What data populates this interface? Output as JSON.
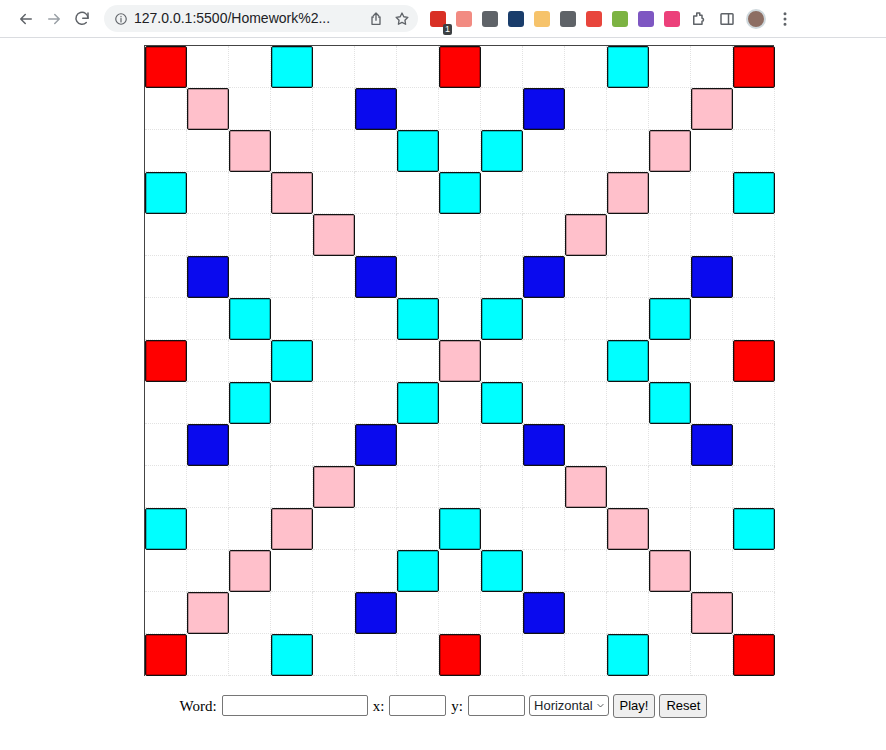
{
  "browser": {
    "address": "127.0.0.1:5500/Homework%2...",
    "extension_badge": "1"
  },
  "board": {
    "rows": [
      [
        "tw",
        "plain",
        "plain",
        "dl",
        "plain",
        "plain",
        "plain",
        "tw",
        "plain",
        "plain",
        "plain",
        "dl",
        "plain",
        "plain",
        "tw"
      ],
      [
        "plain",
        "dw",
        "plain",
        "plain",
        "plain",
        "tl",
        "plain",
        "plain",
        "plain",
        "tl",
        "plain",
        "plain",
        "plain",
        "dw",
        "plain"
      ],
      [
        "plain",
        "plain",
        "dw",
        "plain",
        "plain",
        "plain",
        "dl",
        "plain",
        "dl",
        "plain",
        "plain",
        "plain",
        "dw",
        "plain",
        "plain"
      ],
      [
        "dl",
        "plain",
        "plain",
        "dw",
        "plain",
        "plain",
        "plain",
        "dl",
        "plain",
        "plain",
        "plain",
        "dw",
        "plain",
        "plain",
        "dl"
      ],
      [
        "plain",
        "plain",
        "plain",
        "plain",
        "dw",
        "plain",
        "plain",
        "plain",
        "plain",
        "plain",
        "dw",
        "plain",
        "plain",
        "plain",
        "plain"
      ],
      [
        "plain",
        "tl",
        "plain",
        "plain",
        "plain",
        "tl",
        "plain",
        "plain",
        "plain",
        "tl",
        "plain",
        "plain",
        "plain",
        "tl",
        "plain"
      ],
      [
        "plain",
        "plain",
        "dl",
        "plain",
        "plain",
        "plain",
        "dl",
        "plain",
        "dl",
        "plain",
        "plain",
        "plain",
        "dl",
        "plain",
        "plain"
      ],
      [
        "tw",
        "plain",
        "plain",
        "dl",
        "plain",
        "plain",
        "plain",
        "dw",
        "plain",
        "plain",
        "plain",
        "dl",
        "plain",
        "plain",
        "tw"
      ],
      [
        "plain",
        "plain",
        "dl",
        "plain",
        "plain",
        "plain",
        "dl",
        "plain",
        "dl",
        "plain",
        "plain",
        "plain",
        "dl",
        "plain",
        "plain"
      ],
      [
        "plain",
        "tl",
        "plain",
        "plain",
        "plain",
        "tl",
        "plain",
        "plain",
        "plain",
        "tl",
        "plain",
        "plain",
        "plain",
        "tl",
        "plain"
      ],
      [
        "plain",
        "plain",
        "plain",
        "plain",
        "dw",
        "plain",
        "plain",
        "plain",
        "plain",
        "plain",
        "dw",
        "plain",
        "plain",
        "plain",
        "plain"
      ],
      [
        "dl",
        "plain",
        "plain",
        "dw",
        "plain",
        "plain",
        "plain",
        "dl",
        "plain",
        "plain",
        "plain",
        "dw",
        "plain",
        "plain",
        "dl"
      ],
      [
        "plain",
        "plain",
        "dw",
        "plain",
        "plain",
        "plain",
        "dl",
        "plain",
        "dl",
        "plain",
        "plain",
        "plain",
        "dw",
        "plain",
        "plain"
      ],
      [
        "plain",
        "dw",
        "plain",
        "plain",
        "plain",
        "tl",
        "plain",
        "plain",
        "plain",
        "tl",
        "plain",
        "plain",
        "plain",
        "dw",
        "plain"
      ],
      [
        "tw",
        "plain",
        "plain",
        "dl",
        "plain",
        "plain",
        "plain",
        "tw",
        "plain",
        "plain",
        "plain",
        "dl",
        "plain",
        "plain",
        "tw"
      ]
    ]
  },
  "controls": {
    "word_label": "Word:",
    "x_label": "x:",
    "y_label": "y:",
    "direction": "Horizontal",
    "buttons": [
      "Play!",
      "Reset"
    ]
  }
}
